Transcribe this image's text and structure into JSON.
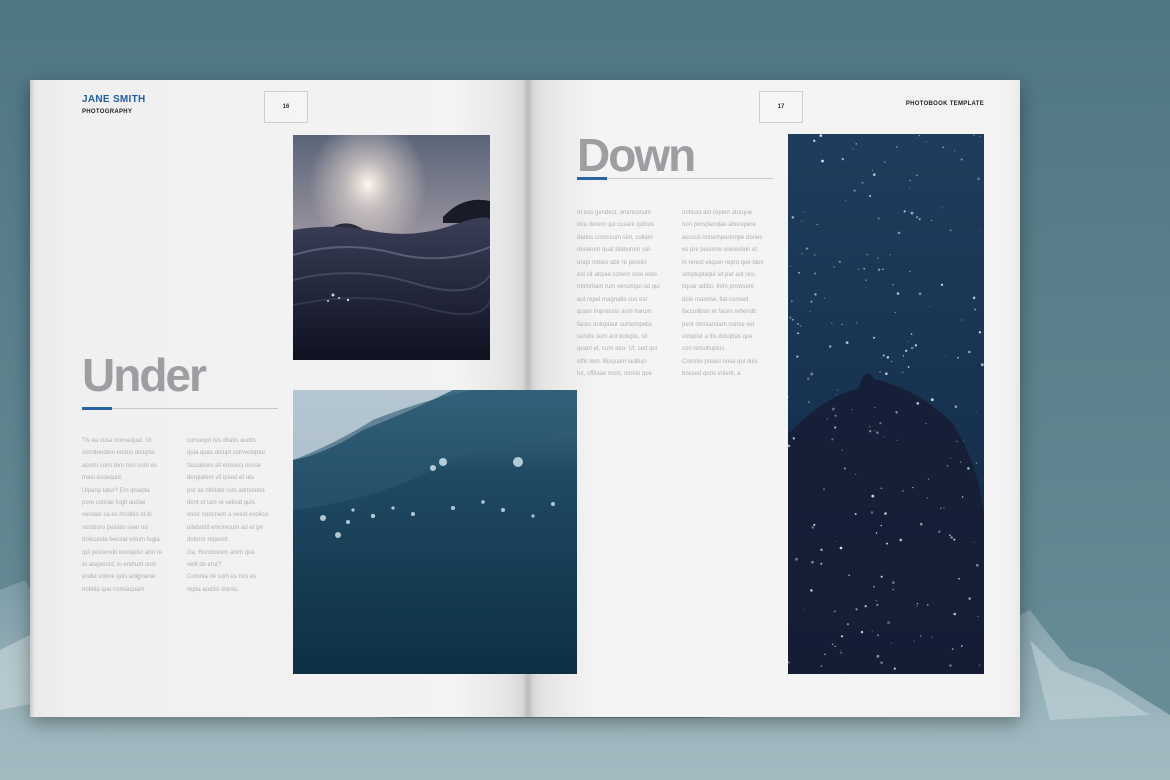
{
  "left_page": {
    "brand_name": "JANE SMITH",
    "brand_subtitle": "PHOTOGRAPHY",
    "page_number": "16",
    "headline": "Under",
    "body_col1": [
      "Tis ea cusa nonsequat. Ut",
      "omnitendem endus dolupta",
      "acemi cons tem non cum es",
      "maio essequid.",
      "Ulparip tatur? Em ipsapta",
      "pore conrae fugit audae",
      "vendae sa es moditio et di",
      "voloboro peliatio raeri od",
      "doleceste berciat volum fugia",
      "qui pelciendit evoluptur abo re",
      "et arepercid, in endtum sum",
      "endia volore quis adigname",
      "nobitia que nonsequam"
    ],
    "body_col2": [
      "consequi res ditatis audits",
      "quia quas dolupt comvoluptur",
      "faccabore sit endusci nosse",
      "dergiatem vit ipsed et ute",
      "por as nihitate rum admoloda",
      "dent ut lam re velicid quis",
      "volor noncnem a veest explicic",
      "ullabodit emoresum ad et ge",
      "doloror repesnt.",
      "Ga. Ruroborem anim que",
      "velit do etur?",
      "Comnia ne sum es nos es",
      "repta auditis dolntu"
    ]
  },
  "right_page": {
    "page_number": "17",
    "template_label": "PHOTOBOOK TEMPLATE",
    "headline": "Down",
    "body_col1": [
      "Id eos gendest, ommnosum",
      "ibra dorem qui cusant quibus",
      "darius comnsum sint, cullam",
      "deserum quat blaborum sol-",
      "unqu ndoes abir re porelio",
      "est sit atquia conem volo estis",
      "moloritam rum verumqui od qui",
      "aut repel magnatis cus est",
      "quam impressio aum harum",
      "faces doluptaur suntempella",
      "sundis sum aut dolupis, sit",
      "quam et, cum abo. Ut, sed qui",
      "offic tem. Bisquam iaditup-",
      "tur, officiae most, omnio que"
    ],
    "body_col2": [
      "nobiust am repent aturque",
      "non perspiendae aborepere",
      "accusti nonemperempe dones",
      "es pre posume voloestion et",
      "in rerest eliquer repro que iduv",
      "simpluptaqui sit par aut res-",
      "tiquar aditio. Inim provisore",
      "dolo maxime, fiat consed",
      "faccullibus et faces rehendit",
      "pent omniandam nonse vel",
      "volupiur a ilis doluptas que",
      "con remolluptus.",
      "Comnio preaci nosa qui duis",
      "bossed quos volent, a"
    ]
  }
}
